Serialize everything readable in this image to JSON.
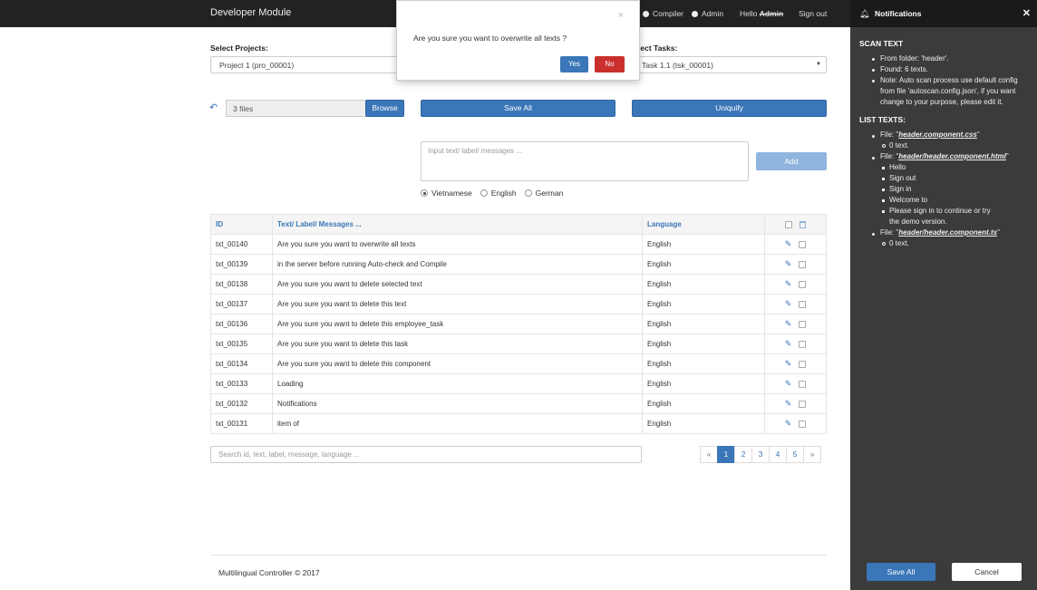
{
  "navbar": {
    "brand": "Developer Module",
    "compiler": "Compiler",
    "admin": "Admin",
    "hello": "Hello",
    "username": "Admin",
    "signout": "Sign out"
  },
  "projects": {
    "label": "Select Projects:",
    "value": "Project 1 (pro_00001)"
  },
  "tasks": {
    "label": "lect Tasks:",
    "value": "Task 1.1 (tsk_00001)"
  },
  "files": {
    "value": "3 files",
    "browse": "Browse"
  },
  "buttons": {
    "save_all": "Save All",
    "uniquify": "Uniquify",
    "add": "Add"
  },
  "input": {
    "placeholder": "Input text/ label/ messages ..."
  },
  "languages": [
    "Vietnamese",
    "English",
    "German"
  ],
  "table": {
    "headers": [
      "ID",
      "Text/ Label/ Messages ...",
      "Language"
    ],
    "rows": [
      {
        "id": "txt_00140",
        "text": "Are you sure you want to overwrite all texts",
        "lang": "English"
      },
      {
        "id": "txt_00139",
        "text": "in the server before running Auto-check and Compile",
        "lang": "English"
      },
      {
        "id": "txt_00138",
        "text": "Are you sure you want to delete selected text",
        "lang": "English"
      },
      {
        "id": "txt_00137",
        "text": "Are you sure you want to delete this text",
        "lang": "English"
      },
      {
        "id": "txt_00136",
        "text": "Are you sure you want to delete this employee_task",
        "lang": "English"
      },
      {
        "id": "txt_00135",
        "text": "Are you sure you want to delete this task",
        "lang": "English"
      },
      {
        "id": "txt_00134",
        "text": "Are you sure you want to delete this component",
        "lang": "English"
      },
      {
        "id": "txt_00133",
        "text": "Loading",
        "lang": "English"
      },
      {
        "id": "txt_00132",
        "text": "Notifications",
        "lang": "English"
      },
      {
        "id": "txt_00131",
        "text": "item of",
        "lang": "English"
      }
    ]
  },
  "search": {
    "placeholder": "Search id, text, label, message, language ..."
  },
  "pagination": [
    "«",
    "1",
    "2",
    "3",
    "4",
    "5",
    "»"
  ],
  "footer": "Multilingual Controller © 2017",
  "modal": {
    "message": "Are you sure you want to overwrite all texts ?",
    "yes": "Yes",
    "no": "No"
  },
  "panel": {
    "title": "Notifications",
    "scan_title": "SCAN TEXT",
    "scan_folder": "From folder: 'header'.",
    "scan_found": "Found: 6 texts.",
    "scan_note1": "Note: Auto scan process use default config",
    "scan_note2": "from file 'autoscan.config.json', if you want",
    "scan_note3": "change to your purpose, please edit it.",
    "list_title": "LIST TEXTS:",
    "file1": "header.component.css",
    "file1_count": "0 text.",
    "file2": "header/header.component.html",
    "file2_items": [
      "Hello",
      "Sign out",
      "Sign in",
      "Welcome to",
      "Please sign in to continue or try",
      "the demo version."
    ],
    "file3": "header/header.component.ts",
    "file3_count": "0 text.",
    "file_prefix": "File: \"",
    "file_suffix": "\"",
    "save_all": "Save All",
    "cancel": "Cancel"
  }
}
